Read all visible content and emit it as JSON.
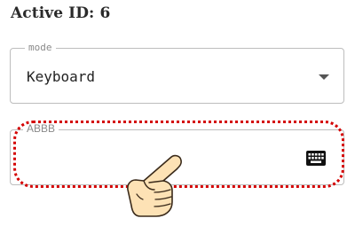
{
  "header": {
    "title": "Active ID: 6"
  },
  "mode_select": {
    "legend": "mode",
    "value": "Keyboard"
  },
  "text_field": {
    "legend": "ABBB",
    "value": ""
  },
  "icons": {
    "dropdown": "chevron-down-icon",
    "keyboard": "keyboard-icon",
    "pointer": "pointing-hand-icon"
  },
  "colors": {
    "highlight": "#d40000",
    "border": "#bdbdbd",
    "legend": "#8a8a8a",
    "hand_fill": "#fde2b5",
    "hand_stroke": "#3a2a1a"
  }
}
